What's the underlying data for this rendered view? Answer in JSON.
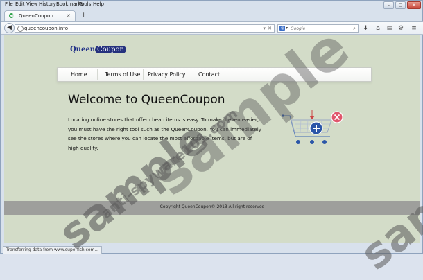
{
  "menu": [
    "File",
    "Edit",
    "View",
    "History",
    "Bookmarks",
    "Tools",
    "Help"
  ],
  "tab": {
    "title": "QueenCoupon",
    "close": "×",
    "new_tab": "+"
  },
  "navbar": {
    "url": "queencoupon.info",
    "search_provider": "g",
    "search_placeholder": "Google"
  },
  "page": {
    "logo_part1": "Queen",
    "logo_part2": "Coupon",
    "nav": [
      "Home",
      "Terms of Use",
      "Privacy Policy",
      "Contact"
    ],
    "heading": "Welcome to QueenCoupon",
    "intro": "Locating online stores that offer cheap items is easy. To make it even easier, you must have the right tool such as the QueenCoupon. You can immediately see the stores where you can locate the most affordable items, but are of high quality.",
    "footer": "Copyright QueenCoupon© 2013 All right reserved"
  },
  "status_bar": "Transferring data from www.superfish.com...",
  "watermark": {
    "word": "sample",
    "site": "anti-spyware101.com"
  },
  "colors": {
    "logo_blue": "#25317e",
    "page_bg": "#d3dcc8",
    "footer_bg": "#9e9f9c"
  }
}
